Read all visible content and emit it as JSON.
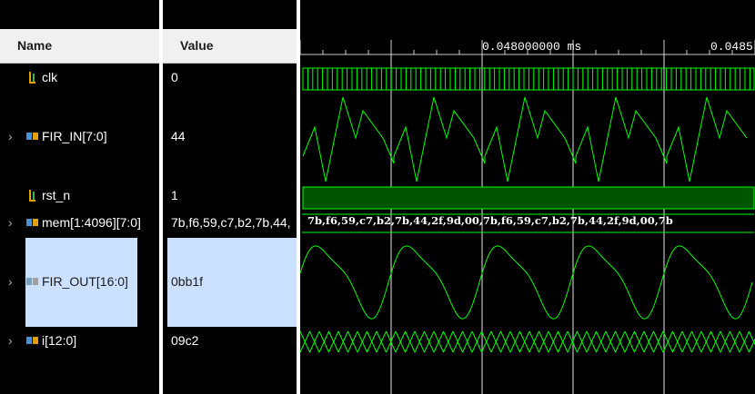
{
  "columns": {
    "name": "Name",
    "value": "Value"
  },
  "signals": [
    {
      "name": "clk",
      "value": "0",
      "icon": "bit-signal-icon",
      "expandable": false
    },
    {
      "name": "FIR_IN[7:0]",
      "value": "44",
      "icon": "bus-signal-icon",
      "expandable": true
    },
    {
      "name": "rst_n",
      "value": "1",
      "icon": "bit-signal-icon",
      "expandable": false
    },
    {
      "name": "mem[1:4096][7:0]",
      "value": "7b,f6,59,c7,b2,7b,44,",
      "icon": "bus-signal-icon",
      "expandable": true
    },
    {
      "name": "FIR_OUT[16:0]",
      "value": "0bb1f",
      "icon": "bus-signal-icon",
      "expandable": true,
      "selected": true
    },
    {
      "name": "i[12:0]",
      "value": "09c2",
      "icon": "bus-signal-icon",
      "expandable": true
    }
  ],
  "waveform": {
    "time_labels": [
      "0.048000000 ms",
      "0.0485"
    ],
    "mem_waveform_text": "7b,f6,59,c7,b2,7b,44,2f,9d,00,7b,f6,59,c7,b2,7b,44,2f,9d,00,7b",
    "colors": {
      "wave": "#00ff00",
      "bus_fill": "#005500",
      "grid": "#e6e6e6",
      "background": "#000000",
      "selected_bg": "#cce0ff"
    }
  }
}
